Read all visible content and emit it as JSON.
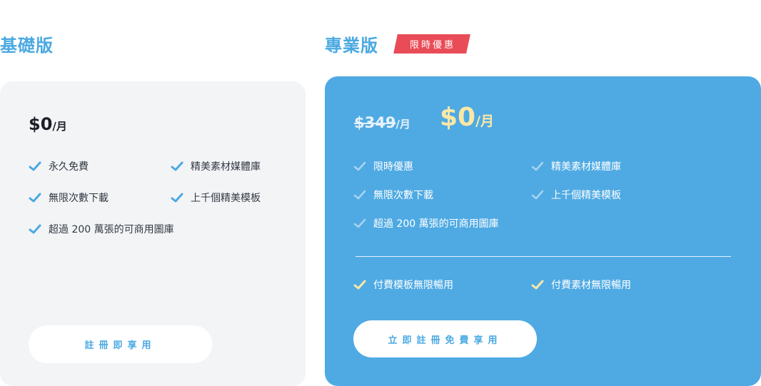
{
  "basic": {
    "title": "基礎版",
    "price": "$0",
    "unit": "/月",
    "features": [
      "永久免費",
      "精美素材媒體庫",
      "無限次數下載",
      "上千個精美模板",
      "超過 200 萬張的可商用圖庫"
    ],
    "button": "註冊即享用"
  },
  "pro": {
    "title": "專業版",
    "badge": "限時優惠",
    "old_price": "$349",
    "old_unit": "/月",
    "price": "$0",
    "unit": "/月",
    "features": [
      "限時優惠",
      "精美素材媒體庫",
      "無限次數下載",
      "上千個精美模板",
      "超過 200 萬張的可商用圖庫"
    ],
    "extras": [
      "付費模板無限暢用",
      "付費素材無限暢用"
    ],
    "button": "立即註冊免費享用"
  },
  "colors": {
    "accent": "#4aa9e2",
    "pro_card": "#4faae3",
    "badge": "#e94c57",
    "price_highlight": "#fbe8a6"
  },
  "icons": {
    "feature": "check-icon"
  }
}
